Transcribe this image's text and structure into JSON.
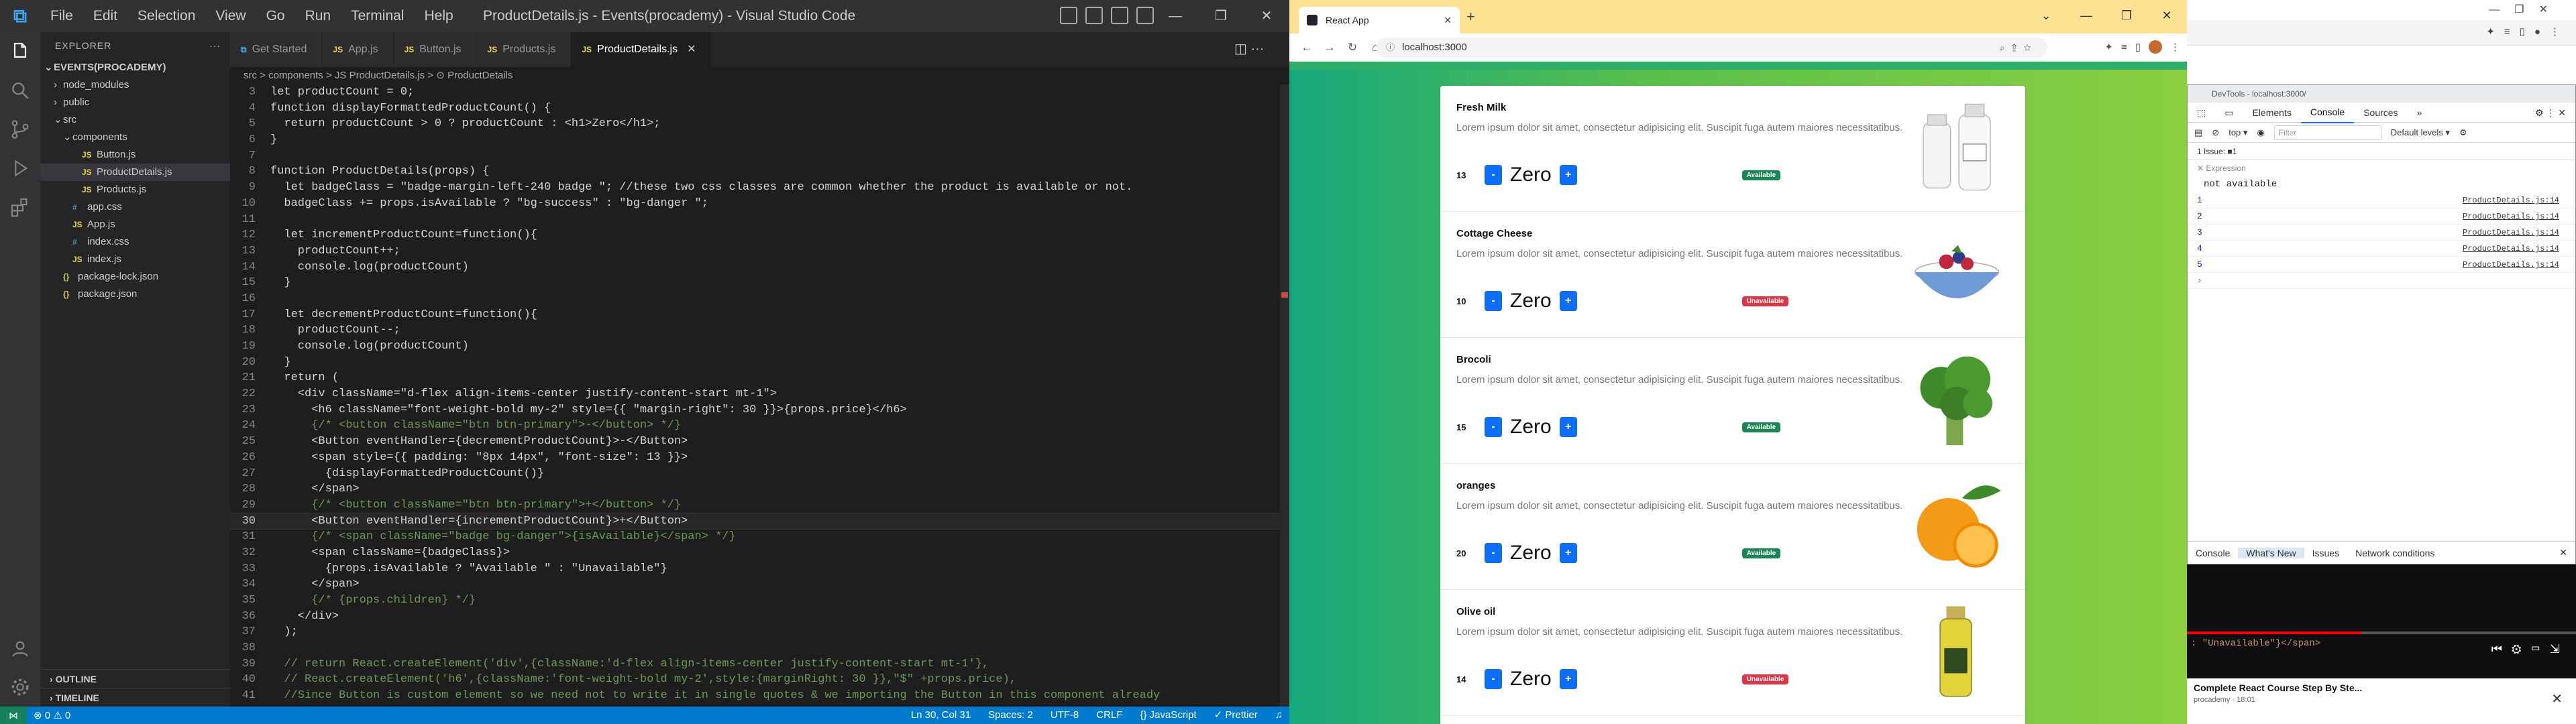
{
  "vscode": {
    "menu": [
      "File",
      "Edit",
      "Selection",
      "View",
      "Go",
      "Run",
      "Terminal",
      "Help"
    ],
    "window_title": "ProductDetails.js - Events(procademy) - Visual Studio Code",
    "explorer_label": "EXPLORER",
    "project": "EVENTS(PROCADEMY)",
    "tree": [
      {
        "label": "node_modules",
        "type": "folder",
        "depth": 1,
        "open": false
      },
      {
        "label": "public",
        "type": "folder",
        "depth": 1,
        "open": false
      },
      {
        "label": "src",
        "type": "folder",
        "depth": 1,
        "open": true
      },
      {
        "label": "components",
        "type": "folder",
        "depth": 2,
        "open": true
      },
      {
        "label": "Button.js",
        "type": "js",
        "depth": 3
      },
      {
        "label": "ProductDetails.js",
        "type": "js",
        "depth": 3,
        "selected": true
      },
      {
        "label": "Products.js",
        "type": "js",
        "depth": 3
      },
      {
        "label": "app.css",
        "type": "css",
        "depth": 2
      },
      {
        "label": "App.js",
        "type": "js",
        "depth": 2
      },
      {
        "label": "index.css",
        "type": "css",
        "depth": 2
      },
      {
        "label": "index.js",
        "type": "js",
        "depth": 2
      },
      {
        "label": "package-lock.json",
        "type": "json",
        "depth": 1
      },
      {
        "label": "package.json",
        "type": "json",
        "depth": 1
      }
    ],
    "outline_label": "OUTLINE",
    "timeline_label": "TIMELINE",
    "tabs": [
      {
        "label": "Get Started",
        "active": false,
        "icon": "vscode"
      },
      {
        "label": "App.js",
        "active": false,
        "icon": "js"
      },
      {
        "label": "Button.js",
        "active": false,
        "icon": "js"
      },
      {
        "label": "Products.js",
        "active": false,
        "icon": "js"
      },
      {
        "label": "ProductDetails.js",
        "active": true,
        "icon": "js"
      }
    ],
    "breadcrumb": "src > components > JS ProductDetails.js > ⊙ ProductDetails",
    "code_lines": [
      {
        "n": 3,
        "t": "let productCount = 0;"
      },
      {
        "n": 4,
        "t": "function displayFormattedProductCount() {"
      },
      {
        "n": 5,
        "t": "  return productCount > 0 ? productCount : <h1>Zero</h1>;"
      },
      {
        "n": 6,
        "t": "}"
      },
      {
        "n": 7,
        "t": ""
      },
      {
        "n": 8,
        "t": "function ProductDetails(props) {"
      },
      {
        "n": 9,
        "t": "  let badgeClass = \"badge-margin-left-240 badge \"; //these two css classes are common whether the product is available or not."
      },
      {
        "n": 10,
        "t": "  badgeClass += props.isAvailable ? \"bg-success\" : \"bg-danger \";"
      },
      {
        "n": 11,
        "t": ""
      },
      {
        "n": 12,
        "t": "  let incrementProductCount=function(){"
      },
      {
        "n": 13,
        "t": "    productCount++;"
      },
      {
        "n": 14,
        "t": "    console.log(productCount)"
      },
      {
        "n": 15,
        "t": "  }"
      },
      {
        "n": 16,
        "t": ""
      },
      {
        "n": 17,
        "t": "  let decrementProductCount=function(){"
      },
      {
        "n": 18,
        "t": "    productCount--;"
      },
      {
        "n": 19,
        "t": "    console.log(productCount)"
      },
      {
        "n": 20,
        "t": "  }"
      },
      {
        "n": 21,
        "t": "  return ("
      },
      {
        "n": 22,
        "t": "    <div className=\"d-flex align-items-center justify-content-start mt-1\">"
      },
      {
        "n": 23,
        "t": "      <h6 className=\"font-weight-bold my-2\" style={{ \"margin-right\": 30 }}>{props.price}</h6>"
      },
      {
        "n": 24,
        "t": "      {/* <button className=\"btn btn-primary\">-</button> */}"
      },
      {
        "n": 25,
        "t": "      <Button eventHandler={decrementProductCount}>-</Button>"
      },
      {
        "n": 26,
        "t": "      <span style={{ padding: \"8px 14px\", \"font-size\": 13 }}>"
      },
      {
        "n": 27,
        "t": "        {displayFormattedProductCount()}"
      },
      {
        "n": 28,
        "t": "      </span>"
      },
      {
        "n": 29,
        "t": "      {/* <button className=\"btn btn-primary\">+</button> */}"
      },
      {
        "n": 30,
        "t": "      <Button eventHandler={incrementProductCount}>+</Button>"
      },
      {
        "n": 31,
        "t": "      {/* <span className=\"badge bg-danger\">{isAvailable}</span> */}"
      },
      {
        "n": 32,
        "t": "      <span className={badgeClass}>"
      },
      {
        "n": 33,
        "t": "        {props.isAvailable ? \"Available \" : \"Unavailable\"}"
      },
      {
        "n": 34,
        "t": "      </span>"
      },
      {
        "n": 35,
        "t": "      {/* {props.children} */}"
      },
      {
        "n": 36,
        "t": "    </div>"
      },
      {
        "n": 37,
        "t": "  );"
      },
      {
        "n": 38,
        "t": ""
      },
      {
        "n": 39,
        "t": "  // return React.createElement('div',{className:'d-flex align-items-center justify-content-start mt-1'},"
      },
      {
        "n": 40,
        "t": "  // React.createElement('h6',{className:'font-weight-bold my-2',style:{marginRight: 30 }},\"$\" +props.price),"
      },
      {
        "n": 41,
        "t": "  //Since Button is custom element so we need not to write it in single quotes & we importing the Button in this component already"
      }
    ],
    "current_line": 30,
    "status": {
      "left": "⊗ 0 ⚠ 0",
      "position": "Ln 30, Col 31",
      "spaces": "Spaces: 2",
      "encoding": "UTF-8",
      "eol": "CRLF",
      "language": "{} JavaScript",
      "prettier": "✓ Prettier"
    }
  },
  "chrome": {
    "tab_title": "React App",
    "url": "localhost:3000",
    "products": [
      {
        "name": "Fresh Milk",
        "desc": "Lorem ipsum dolor sit amet, consectetur adipisicing elit. Suscipit fuga autem maiores necessitatibus.",
        "price": "13",
        "count": "Zero",
        "minus": "-",
        "plus": "+",
        "badge": "Available",
        "available": true,
        "image": "milk-bottles"
      },
      {
        "name": "Cottage Cheese",
        "desc": "Lorem ipsum dolor sit amet, consectetur adipisicing elit. Suscipit fuga autem maiores necessitatibus.",
        "price": "10",
        "count": "Zero",
        "minus": "-",
        "plus": "+",
        "badge": "Unavailable",
        "available": false,
        "image": "cheese-bowl"
      },
      {
        "name": "Brocoli",
        "desc": "Lorem ipsum dolor sit amet, consectetur adipisicing elit. Suscipit fuga autem maiores necessitatibus.",
        "price": "15",
        "count": "Zero",
        "minus": "-",
        "plus": "+",
        "badge": "Available",
        "available": true,
        "image": "broccoli"
      },
      {
        "name": "oranges",
        "desc": "Lorem ipsum dolor sit amet, consectetur adipisicing elit. Suscipit fuga autem maiores necessitatibus.",
        "price": "20",
        "count": "Zero",
        "minus": "-",
        "plus": "+",
        "badge": "Available",
        "available": true,
        "image": "orange"
      },
      {
        "name": "Olive oil",
        "desc": "Lorem ipsum dolor sit amet, consectetur adipisicing elit. Suscipit fuga autem maiores necessitatibus.",
        "price": "14",
        "count": "Zero",
        "minus": "-",
        "plus": "+",
        "badge": "Unavailable",
        "available": false,
        "image": "olive-oil"
      }
    ]
  },
  "devtools": {
    "title": "DevTools - localhost:3000/",
    "tabs": [
      "Elements",
      "Console",
      "Sources",
      "»"
    ],
    "active_tab": "Console",
    "context": "top ▾",
    "filter_placeholder": "Filter",
    "levels": "Default levels ▾",
    "issues": "1 Issue: ■1",
    "expression_label": "Expression",
    "expression_value": "not available",
    "logs": [
      {
        "value": "1",
        "source": "ProductDetails.js:14"
      },
      {
        "value": "2",
        "source": "ProductDetails.js:14"
      },
      {
        "value": "3",
        "source": "ProductDetails.js:14"
      },
      {
        "value": "4",
        "source": "ProductDetails.js:14"
      },
      {
        "value": "5",
        "source": "ProductDetails.js:14"
      }
    ],
    "drawer_tabs": [
      "Console",
      "What's New",
      "Issues",
      "Network conditions"
    ],
    "drawer_active": "What's New"
  },
  "video": {
    "code_snippet": ": \"Unavailable\"}</span>",
    "title": "Complete React Course Step By Ste...",
    "channel": "procademy · 18:01"
  },
  "colors": {
    "vscode_bg": "#1e1e1e",
    "statusbar": "#007acc",
    "page_gradient_start": "#16a87d",
    "page_gradient_end": "#8bd040",
    "primary_button": "#0d6efd",
    "badge_success": "#198754",
    "badge_danger": "#dc3545",
    "chrome_tabbar": "#fde293"
  }
}
